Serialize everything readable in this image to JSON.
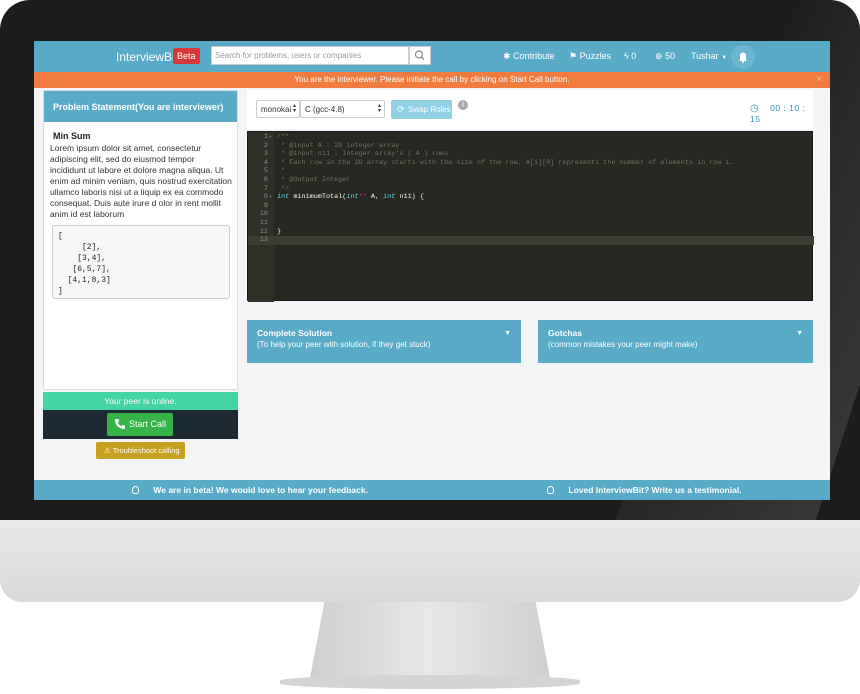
{
  "navbar": {
    "logo_text": "InterviewBit",
    "beta_badge": "Beta",
    "search_placeholder": "Search for problems, users or companies",
    "contribute_label": "Contribute",
    "puzzles_label": "Puzzles",
    "lightning_count": "0",
    "coins_count": "50",
    "user_name": "Tushar",
    "icons": {
      "search": "search-icon",
      "contribute": "gear-icon",
      "puzzles": "flag-icon",
      "lightning": "lightning-icon",
      "coins": "coin-icon",
      "bell": "bell-icon"
    }
  },
  "alert": {
    "message": "You are the interviewer. Please initiate the call by clicking on Start Call button.",
    "close": "×"
  },
  "problem": {
    "header": "Problem Statement(You are interviewer)",
    "title": "Min Sum",
    "description": "Lorem ipsum dolor sit amet, consectetur adipiscing elit, sed do eiusmod tempor incididunt ut labore et dolore magna aliqua. Ut enim ad minim veniam, quis nostrud exercitation ullamco laboris nisi ut a liquip ex ea commodo consequat. Duis aute irure d olor in rent mollit anim id est laborum",
    "sample": "[\n     [2],\n    [3,4],\n   [6,5,7],\n  [4,1,8,3]\n]"
  },
  "call": {
    "peer_status": "Your peer is online.",
    "start_call_label": "Start Call",
    "troubleshoot_label": "Troubleshoot calling"
  },
  "editor_toolbar": {
    "theme": "monokai",
    "language": "C (gcc-4.8)",
    "swap_roles_label": "Swap Roles",
    "info_icon": "i",
    "timer": "00 : 10 : 15"
  },
  "code_lines": [
    {
      "num": "1",
      "fold": "▾",
      "text": "/**",
      "cls": "cmt"
    },
    {
      "num": "2",
      "fold": "",
      "text": " * @input A : 2D integer array",
      "cls": "cmt"
    },
    {
      "num": "3",
      "fold": "",
      "text": " * @input n11 : Integer array's ( A ) rows",
      "cls": "cmt"
    },
    {
      "num": "4",
      "fold": "",
      "text": " * Each row in the 2D array starts with the size of the row. A[i][0] represents the number of elements in row i.",
      "cls": "cmt"
    },
    {
      "num": "5",
      "fold": "",
      "text": " *",
      "cls": "cmt"
    },
    {
      "num": "6",
      "fold": "",
      "text": " * @Output Integer",
      "cls": "cmt"
    },
    {
      "num": "7",
      "fold": "",
      "text": " */",
      "cls": "cmt"
    },
    {
      "num": "8",
      "fold": "▾",
      "parts": [
        {
          "t": "int",
          "c": "kw"
        },
        {
          "t": " minimumTotal(",
          "c": "plain"
        },
        {
          "t": "int",
          "c": "kw"
        },
        {
          "t": "**",
          "c": "op"
        },
        {
          "t": " A, ",
          "c": "plain"
        },
        {
          "t": "int",
          "c": "kw"
        },
        {
          "t": " n11) {",
          "c": "plain"
        }
      ]
    },
    {
      "num": "9",
      "fold": "",
      "text": "",
      "cls": "plain"
    },
    {
      "num": "10",
      "fold": "",
      "text": "",
      "cls": "plain"
    },
    {
      "num": "11",
      "fold": "",
      "text": "",
      "cls": "plain"
    },
    {
      "num": "12",
      "fold": "",
      "text": "}",
      "cls": "plain"
    },
    {
      "num": "13",
      "fold": "",
      "text": "",
      "cls": "plain",
      "active": true
    }
  ],
  "cards": {
    "solution_title": "Complete Solution",
    "solution_sub": "(To help your peer with solution, if they get stuck)",
    "gotchas_title": "Gotchas",
    "gotchas_sub": "(common mistakes your peer might make)",
    "caret": "▼"
  },
  "footer": {
    "feedback": "We are in beta! We would love to hear your feedback.",
    "testimonial": "Loved InterviewBit? Write us a testimonial."
  }
}
